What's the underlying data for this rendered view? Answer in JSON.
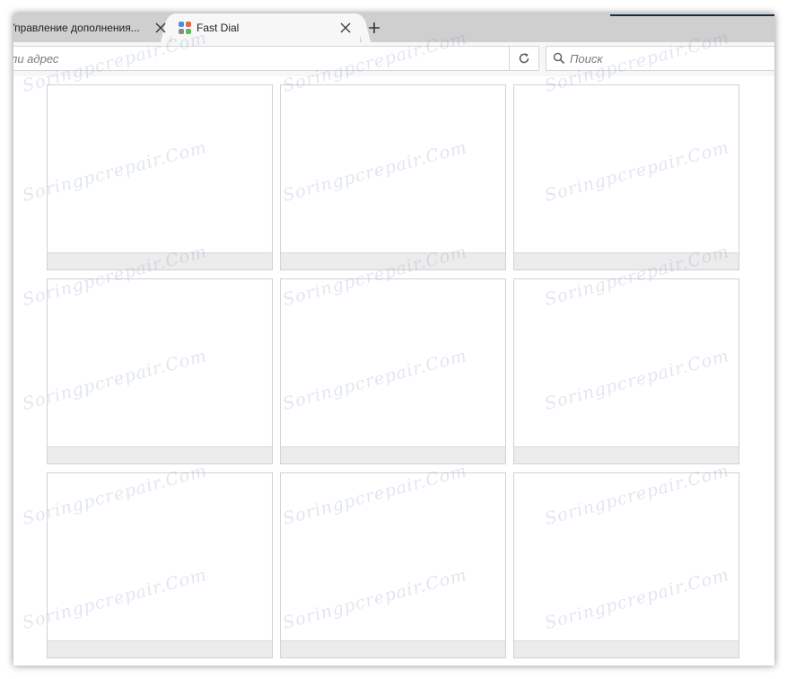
{
  "tabs": [
    {
      "title": "Управление дополнения...",
      "active": false
    },
    {
      "title": "Fast Dial",
      "active": true
    }
  ],
  "favicon_colors": [
    "#4a8fd8",
    "#e06a4f",
    "#8a8a8a",
    "#5cb85c"
  ],
  "toolbar": {
    "url_placeholder": "ли адрес",
    "search_placeholder": "Поиск"
  },
  "dial_tiles": [
    {
      "caption": ""
    },
    {
      "caption": ""
    },
    {
      "caption": ""
    },
    {
      "caption": ""
    },
    {
      "caption": ""
    },
    {
      "caption": ""
    },
    {
      "caption": ""
    },
    {
      "caption": ""
    },
    {
      "caption": ""
    }
  ],
  "watermark": "Soringpcrepair.Com",
  "colors": {
    "tabstrip": "#cfcfcf",
    "toolbar": "#f7f7f7",
    "tile_border": "#d2d2d2",
    "tile_caption": "#ececec"
  }
}
